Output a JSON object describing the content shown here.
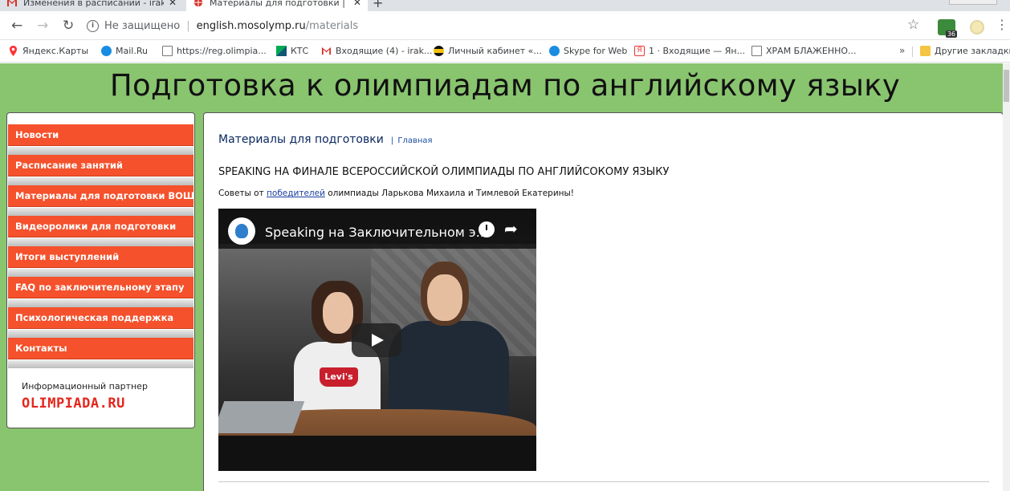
{
  "browser": {
    "tabs": [
      {
        "title": "Изменения в расписании - irak",
        "active": false
      },
      {
        "title": "Материалы для подготовки | ПС",
        "active": true
      }
    ],
    "new_tab": "+",
    "address": {
      "status": "Не защищено",
      "host": "english.mosolymp.ru",
      "path": "/materials"
    },
    "extension_badge": "36",
    "bookmarks": [
      "Яндекс.Карты",
      "Mail.Ru",
      "https://reg.olimpia...",
      "КТС",
      "Входящие (4) - irak...",
      "Личный кабинет «...",
      "Skype for Web",
      "1 · Входящие — Ян...",
      "ХРАМ БЛАЖЕННО..."
    ],
    "bookmarks_overflow": "»",
    "other_bookmarks": "Другие закладки"
  },
  "site": {
    "title": "Подготовка к олимпиадам по английскому языку"
  },
  "sidebar": {
    "items": [
      {
        "label": "Новости"
      },
      {
        "label": "Расписание занятий"
      },
      {
        "label": "Материалы для подготовки ВОШ"
      },
      {
        "label": "Видеоролики для подготовки"
      },
      {
        "label": "Итоги выступлений"
      },
      {
        "label": "FAQ по заключительному этапу"
      },
      {
        "label": "Психологическая поддержка"
      },
      {
        "label": "Контакты"
      }
    ],
    "partner_label": "Информационный партнер",
    "partner_logo": "OLIMPIADA.RU"
  },
  "content": {
    "heading": "Материалы для подготовки",
    "breadcrumb_sep": "|",
    "breadcrumb_home": "Главная",
    "article_title": "SPEAKING НА ФИНАЛЕ ВСЕРОССИЙСКОЙ ОЛИМПИАДЫ ПО АНГЛИЙСОКОМУ ЯЗЫКУ",
    "text_before_link": "Советы от ",
    "link_text": "победителей",
    "text_after_link": " олимпиады Ларькова Михаила и Тимлевой Екатерины!",
    "video": {
      "title": "Speaking на Заключительном э...",
      "shirt_text": "Levi's"
    }
  },
  "colors": {
    "page_bg": "#89c46f",
    "menu_item": "#f4512c",
    "link": "#1c4fa0"
  }
}
